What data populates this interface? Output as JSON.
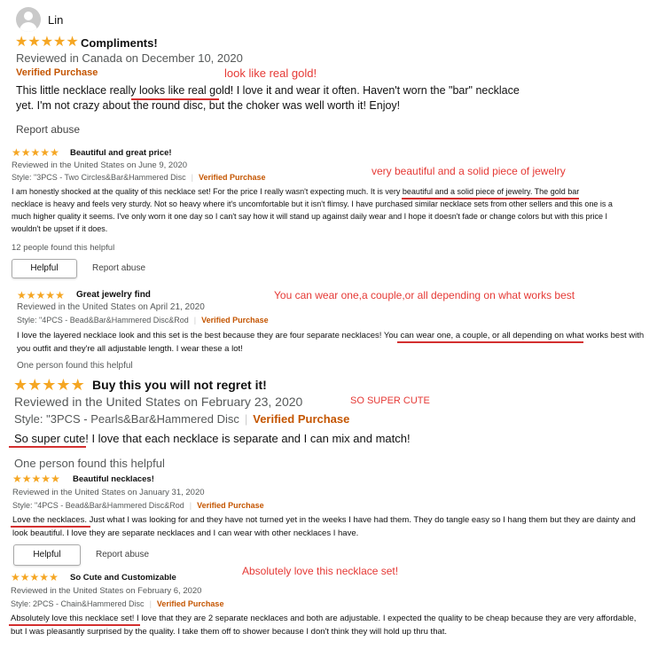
{
  "reviewer": {
    "name": "Lin"
  },
  "reviews": [
    {
      "title": "Compliments!",
      "date": "Reviewed in Canada on December 10, 2020",
      "verified": "Verified Purchase",
      "body": [
        "This little necklace really looks like real gold! I love it and wear it often. Haven't worn the \"bar\" necklace",
        "yet. I'm not crazy about the round disc, but the choker was well worth it! Enjoy!"
      ],
      "report": "Report abuse",
      "annotation": "look like real gold!"
    },
    {
      "title": "Beautiful and great price!",
      "date": "Reviewed in the United States on June 9, 2020",
      "style": "Style: \"3PCS - Two Circles&Bar&Hammered Disc",
      "verified": "Verified Purchase",
      "body": [
        "I am honestly shocked at the quality of this necklace set! For the price I really wasn't expecting much. It is very beautiful and a solid piece of jewelry. The gold bar",
        "necklace is heavy and feels very sturdy. Not so heavy where it's uncomfortable but it isn't flimsy. I have purchased similar necklace sets from other sellers and this one is a",
        "much higher quality it seems. I've only worn it one day so I can't say how it will stand up against daily wear and I hope it doesn't fade or change colors but with this price I",
        "wouldn't be upset if it does."
      ],
      "helpful_count": "12 people found this helpful",
      "helpful_button": "Helpful",
      "report": "Report abuse",
      "annotation": "very beautiful and a solid piece of jewelry"
    },
    {
      "title": "Great jewelry find",
      "date": "Reviewed in the United States on April 21, 2020",
      "style": "Style: \"4PCS - Bead&Bar&Hammered Disc&Rod",
      "verified": "Verified Purchase",
      "body": [
        "I love the layered necklace look and this set is the best because they are four separate necklaces! You can wear one, a couple, or all depending on what works best with",
        "you outfit and they're all adjustable length. I wear these a lot!"
      ],
      "helpful_count": "One person found this helpful",
      "annotation": "You can wear one,a couple,or all depending on what works best"
    },
    {
      "title": "Buy this you will not regret it!",
      "date": "Reviewed in the United States on February 23, 2020",
      "style": "Style: \"3PCS - Pearls&Bar&Hammered Disc",
      "verified": "Verified Purchase",
      "body": [
        "So super cute! I love that each necklace is separate and I can mix and match!"
      ],
      "helpful_count": "One person found this helpful",
      "annotation": "SO SUPER CUTE"
    },
    {
      "title": "Beautiful necklaces!",
      "date": "Reviewed in the United States on January 31, 2020",
      "style": "Style: \"4PCS - Bead&Bar&Hammered Disc&Rod",
      "verified": "Verified Purchase",
      "body": [
        "Love the necklaces. Just what I was looking for and they have not turned yet in the weeks I have had them. They do tangle easy so I hang them but they are dainty and",
        "look beautiful. I love they are separate necklaces and I can wear with other necklaces I have."
      ],
      "helpful_button": "Helpful",
      "report": "Report abuse"
    },
    {
      "title": "So Cute and Customizable",
      "date": "Reviewed in the United States on February 6, 2020",
      "style": "Style: 2PCS - Chain&Hammered Disc",
      "verified": "Verified Purchase",
      "body": [
        "Absolutely love this necklace set! I love that they are 2 separate necklaces and both are adjustable. I expected the quality to be cheap because they are very affordable,",
        "but I was pleasantly surprised by the quality. I take them off to shower because I don't think they will hold up thru that."
      ],
      "annotation": "Absolutely love this necklace set!"
    }
  ],
  "colors": {
    "star": "#f5a623",
    "verified": "#c45500",
    "annotation": "#e53935",
    "underline": "#d32f2f"
  }
}
